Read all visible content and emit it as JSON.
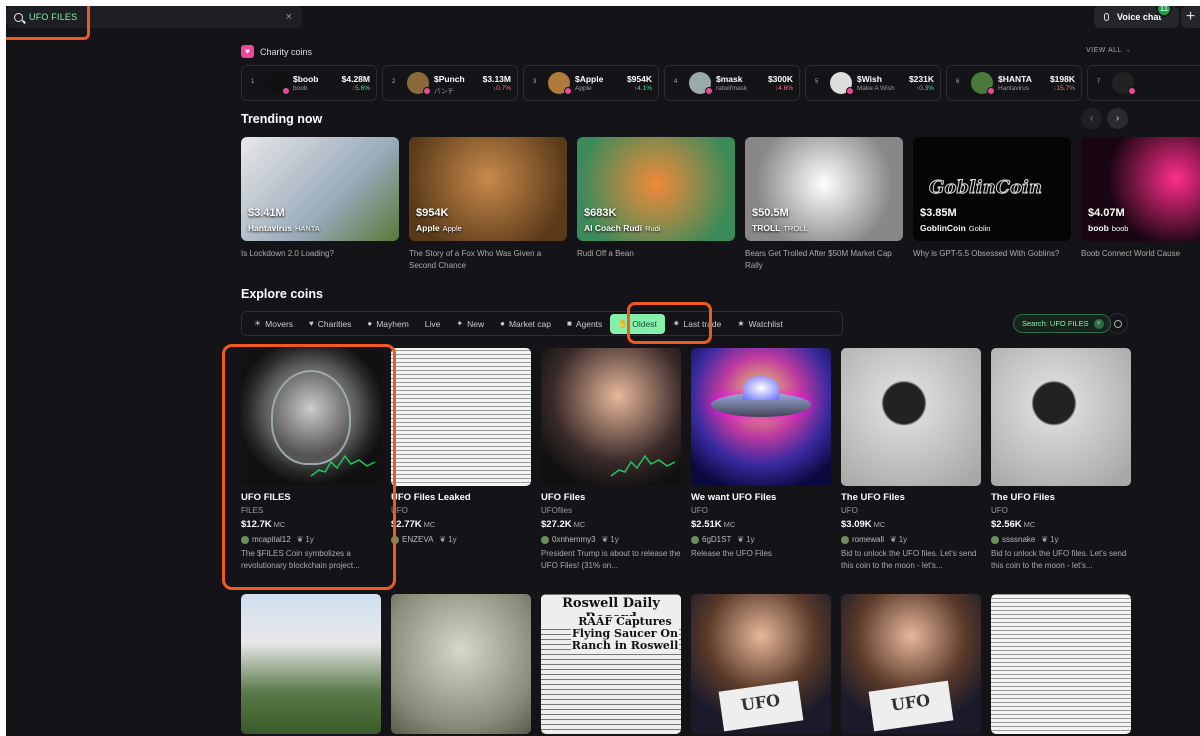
{
  "search": {
    "value": "UFO FILES",
    "clear": "×"
  },
  "topbar": {
    "voice_label": "Voice chat",
    "live_count": "11",
    "plus": "+"
  },
  "charity": {
    "title": "Charity coins",
    "view_all": "VIEW ALL →",
    "items": [
      {
        "rank": "1",
        "name": "$boob",
        "ticker": "boob",
        "mcap": "$4.28M",
        "change": "↑5.6%",
        "dir": "up",
        "color": "#111"
      },
      {
        "rank": "2",
        "name": "$Punch",
        "ticker": "パンチ",
        "mcap": "$3.13M",
        "change": "↓0.7%",
        "dir": "dn",
        "color": "#8a6a3a"
      },
      {
        "rank": "3",
        "name": "$Apple",
        "ticker": "Apple",
        "mcap": "$954K",
        "change": "↑4.1%",
        "dir": "up",
        "color": "#b07b3a"
      },
      {
        "rank": "4",
        "name": "$mask",
        "ticker": "ratwifmask",
        "mcap": "$300K",
        "change": "↓4.6%",
        "dir": "dn",
        "color": "#9aa"
      },
      {
        "rank": "5",
        "name": "$Wish",
        "ticker": "Make A Wish",
        "mcap": "$231K",
        "change": "↑0.3%",
        "dir": "up",
        "color": "#ddd"
      },
      {
        "rank": "6",
        "name": "$HANTA",
        "ticker": "Hantavirus",
        "mcap": "$198K",
        "change": "↓15.7%",
        "dir": "dn",
        "color": "#4a7a3a"
      },
      {
        "rank": "7",
        "name": "",
        "ticker": "",
        "mcap": "",
        "change": "",
        "dir": "up",
        "color": "#222"
      }
    ]
  },
  "trending": {
    "title": "Trending now",
    "prev": "‹",
    "next": "›",
    "items": [
      {
        "mcap": "$3.41M",
        "name": "Hantavirus",
        "ticker": "HANTA",
        "desc": "Is Lockdown 2.0 Loading?",
        "bg": "linear-gradient(135deg,#e8e8e8,#9ab 60%,#5a7a3a)"
      },
      {
        "mcap": "$954K",
        "name": "Apple",
        "ticker": "Apple",
        "desc": "The Story of a Fox Who Was Given a Second Chance",
        "bg": "radial-gradient(circle at 50% 40%,#c88a4a,#5a3a1a 80%)"
      },
      {
        "mcap": "$683K",
        "name": "AI Coach Rudi",
        "ticker": "Rudi",
        "desc": "Rudi Off a Bean",
        "bg": "radial-gradient(circle at 50% 45%,#f08a3a,#3a8a5a 80%)"
      },
      {
        "mcap": "$50.5M",
        "name": "TROLL",
        "ticker": "TROLL",
        "desc": "Bears Get Trolled After $50M Market Cap Rally",
        "bg": "radial-gradient(circle at 50% 45%,#fff,#888 70%)"
      },
      {
        "mcap": "$3.85M",
        "name": "GoblinCoin",
        "ticker": "Goblin",
        "desc": "Why is GPT-5.5 Obsessed With Goblins?",
        "bg": "#050505",
        "logo": "GoblinCoin"
      },
      {
        "mcap": "$4.07M",
        "name": "boob",
        "ticker": "boob",
        "desc": "Boob Connect World Cause",
        "bg": "radial-gradient(circle at 60% 40%,#ff2d8a,#1a0612 60%)"
      }
    ]
  },
  "explore": {
    "title": "Explore coins",
    "tabs": [
      {
        "icon": "☀",
        "label": "Movers",
        "icon_name": "sun-icon"
      },
      {
        "icon": "♥",
        "label": "Charities",
        "icon_name": "heart-icon"
      },
      {
        "icon": "●",
        "label": "Mayhem",
        "icon_name": "fire-icon"
      },
      {
        "icon": "",
        "label": "Live",
        "icon_name": "live-icon"
      },
      {
        "icon": "✦",
        "label": "New",
        "icon_name": "sprout-icon"
      },
      {
        "icon": "●",
        "label": "Market cap",
        "icon_name": "moneybag-icon"
      },
      {
        "icon": "■",
        "label": "Agents",
        "icon_name": "robot-icon"
      },
      {
        "icon": "✋",
        "label": "Oldest",
        "icon_name": "hand-icon",
        "active": true
      },
      {
        "icon": "✷",
        "label": "Last trade",
        "icon_name": "spark-icon"
      },
      {
        "icon": "★",
        "label": "Watchlist",
        "icon_name": "star-icon"
      }
    ],
    "filter_chip": "Search: UFO FILES",
    "chip_close": "×"
  },
  "coins": [
    {
      "name": "UFO FILES",
      "ticker": "FILES",
      "mcap": "$12.7K",
      "unit": "MC",
      "user": "mcapital12",
      "age": "1y",
      "desc": "The $FILES Coin symbolizes a revolutionary blockchain project...",
      "bg": "radial-gradient(circle at 50% 45%,#c9c9c9,#5a5a5a 45%,#2a2a2a 60%,#111 72%)"
    },
    {
      "name": "UFO Files Leaked",
      "ticker": "UFO",
      "mcap": "$2.77K",
      "unit": "MC",
      "user": "ENZEVA",
      "age": "1y",
      "desc": "",
      "bg": "repeating-linear-gradient(0deg,#f4f4f4 0 3px,#999 3px 4px)"
    },
    {
      "name": "UFO Files",
      "ticker": "UFOfiles",
      "mcap": "$27.2K",
      "unit": "MC",
      "user": "0xnhemmy3",
      "age": "1y",
      "desc": "President Trump is about to release the UFO Files! (31% on...",
      "bg": "radial-gradient(circle at 55% 35%,#e8b89a,#3a2a2a 55%,#111 80%)"
    },
    {
      "name": "We want UFO Files",
      "ticker": "UFO",
      "mcap": "$2.51K",
      "unit": "MC",
      "user": "6gD1ST",
      "age": "1y",
      "desc": "Release the UFO Files",
      "bg": "radial-gradient(circle at 50% 35%,#f0e060,#c03aa0 35%,#3a2aa0 60%,#0a0a40 85%)"
    },
    {
      "name": "The UFO Files",
      "ticker": "UFO",
      "mcap": "$3.09K",
      "unit": "MC",
      "user": "romewall",
      "age": "1y",
      "desc": "Bid to unlock the UFO files. Let's send this coin to the moon - let's...",
      "bg": "radial-gradient(circle at 45% 40%,#222 0 18%,#d8d8d8 20%,#a8a8a8 90%)"
    },
    {
      "name": "The UFO Files",
      "ticker": "UFO",
      "mcap": "$2.56K",
      "unit": "MC",
      "user": "ssssnake",
      "age": "1y",
      "desc": "Bid to unlock the UFO files. Let's send this coin to the moon - let's...",
      "bg": "radial-gradient(circle at 45% 40%,#222 0 18%,#d8d8d8 20%,#a8a8a8 90%)"
    }
  ],
  "coins_row2": [
    {
      "bg": "linear-gradient(180deg,#cfe0f0,#e8e8e8 35%,#5a7a4a 70%,#3a5a2a)"
    },
    {
      "bg": "radial-gradient(circle at 50% 40%,#d8d8c8,#8a8a7a 70%,#5a5a4a)"
    },
    {
      "bg": "repeating-linear-gradient(0deg,#eee 0 4px,#777 4px 5px)",
      "headline": "Roswell Daily Record",
      "subhead": "RAAF Captures Flying Saucer On Ranch in Roswell"
    },
    {
      "bg": "radial-gradient(circle at 50% 30%,#e8b89a,#5a3a2a 45%,#1a1a2a 75%)",
      "badge": "UFO"
    },
    {
      "bg": "radial-gradient(circle at 50% 30%,#e8b89a,#5a3a2a 45%,#1a1a2a 75%)",
      "badge": "UFO"
    },
    {
      "bg": "repeating-linear-gradient(0deg,#f4f4f4 0 3px,#999 3px 4px)"
    }
  ]
}
